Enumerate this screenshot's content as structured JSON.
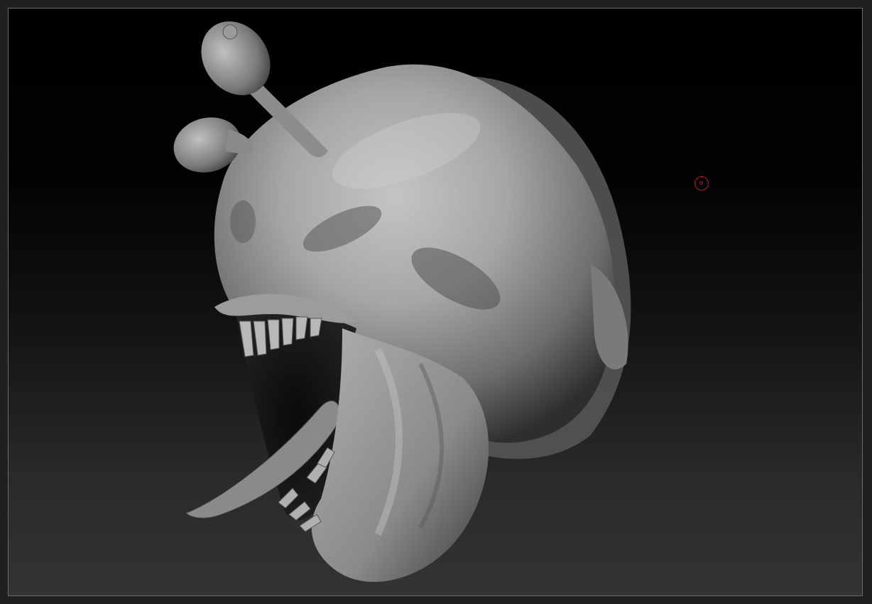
{
  "canvas": {
    "name": "zbrush-document-canvas",
    "background_top": "#000000",
    "background_bottom": "#333333",
    "frame_color": "#6a6a6a"
  },
  "model": {
    "name": "creature-head-sculpt",
    "material_color": "#a8a8a8"
  },
  "cursor": {
    "name": "draw-brush-cursor",
    "color": "#c0141a"
  }
}
